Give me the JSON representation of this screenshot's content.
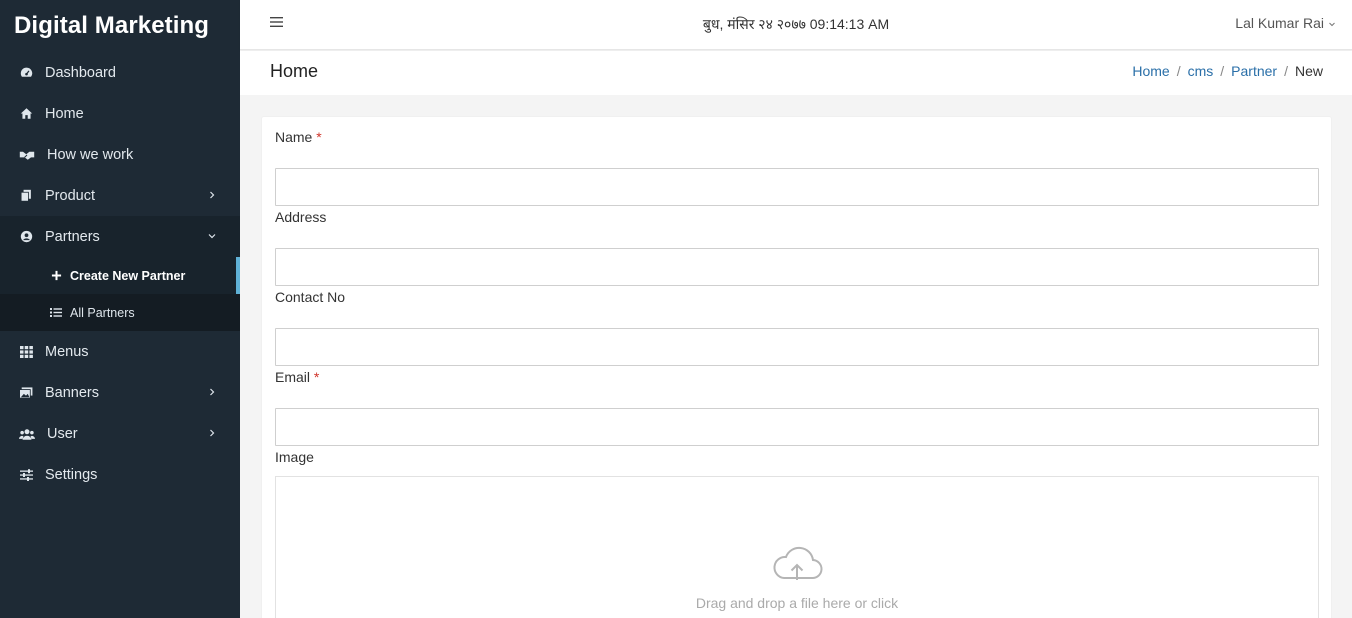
{
  "brand": "Digital Marketing",
  "sidebar": {
    "items": [
      {
        "label": "Dashboard",
        "icon": "dashboard-icon"
      },
      {
        "label": "Home",
        "icon": "home-icon"
      },
      {
        "label": "How we work",
        "icon": "handshake-icon"
      },
      {
        "label": "Product",
        "icon": "copy-icon",
        "submenu": "collapsed"
      },
      {
        "label": "Partners",
        "icon": "user-circle-icon",
        "submenu": "expanded"
      },
      {
        "label": "Menus",
        "icon": "grid-icon"
      },
      {
        "label": "Banners",
        "icon": "images-icon",
        "submenu": "collapsed"
      },
      {
        "label": "User",
        "icon": "users-icon",
        "submenu": "collapsed"
      },
      {
        "label": "Settings",
        "icon": "sliders-icon"
      }
    ],
    "partners_sub": [
      {
        "label": "Create New Partner",
        "icon": "plus-icon",
        "active": true
      },
      {
        "label": "All Partners",
        "icon": "list-icon",
        "active": false
      }
    ]
  },
  "header": {
    "datetime": "बुध, मंसिर २४ २०७७ 09:14:13 AM",
    "user": "Lal Kumar Rai"
  },
  "page": {
    "title": "Home",
    "breadcrumb": [
      "Home",
      "cms",
      "Partner",
      "New"
    ]
  },
  "form": {
    "fields": [
      {
        "label": "Name",
        "required": true,
        "value": ""
      },
      {
        "label": "Address",
        "required": false,
        "value": ""
      },
      {
        "label": "Contact No",
        "required": false,
        "value": ""
      },
      {
        "label": "Email",
        "required": true,
        "value": ""
      }
    ],
    "image_label": "Image",
    "dropzone_text": "Drag and drop a file here or click",
    "required_mark": "*"
  },
  "colors": {
    "sidebar_bg": "#1e2a35",
    "active_indicator": "#5fb1d6",
    "link": "#2a6fa8",
    "required": "#d0352b"
  }
}
